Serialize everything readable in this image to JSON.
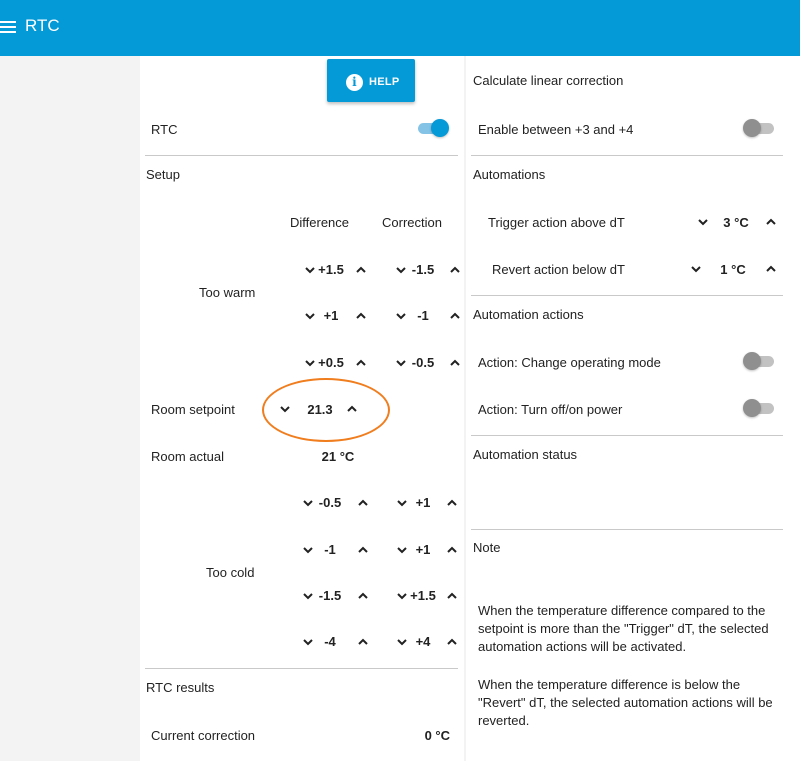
{
  "app": {
    "title": "RTC",
    "menu_icon": "menu-icon"
  },
  "left": {
    "help_label": "HELP",
    "rtc_label": "RTC",
    "rtc_enabled": true,
    "setup_label": "Setup",
    "header_difference": "Difference",
    "header_correction": "Correction",
    "too_warm_label": "Too warm",
    "warm_rows": [
      {
        "difference": "+1.5",
        "correction": "-1.5"
      },
      {
        "difference": "+1",
        "correction": "-1"
      },
      {
        "difference": "+0.5",
        "correction": "-0.5"
      }
    ],
    "room_setpoint_label": "Room setpoint",
    "room_setpoint_value": "21.3",
    "room_actual_label": "Room actual",
    "room_actual_value": "21 °C",
    "too_cold_label": "Too cold",
    "cold_rows": [
      {
        "difference": "-0.5",
        "correction": "+1"
      },
      {
        "difference": "-1",
        "correction": "+1"
      },
      {
        "difference": "-1.5",
        "correction": "+1.5"
      },
      {
        "difference": "-4",
        "correction": "+4"
      }
    ],
    "results_label": "RTC results",
    "current_correction_label": "Current correction",
    "current_correction_value": "0 °C"
  },
  "right": {
    "linear_title": "Calculate linear correction",
    "enable_between_label": "Enable between +3 and +4",
    "enable_between_on": false,
    "automations_title": "Automations",
    "trigger_label": "Trigger action above dT",
    "trigger_value": "3 °C",
    "revert_label": "Revert action below dT",
    "revert_value": "1 °C",
    "actions_title": "Automation actions",
    "action_mode_label": "Action: Change operating mode",
    "action_mode_on": false,
    "action_power_label": "Action: Turn off/on power",
    "action_power_on": false,
    "status_title": "Automation status",
    "note_title": "Note",
    "note_text_1": "When the temperature difference compared to the setpoint is more than the \"Trigger\" dT, the selected automation actions will be activated.",
    "note_text_2": "When the temperature difference is below the \"Revert\" dT, the selected automation actions will be reverted."
  },
  "colors": {
    "primary": "#0499d7",
    "annotation": "#f07d1e",
    "divider": "#c9c9c9"
  }
}
